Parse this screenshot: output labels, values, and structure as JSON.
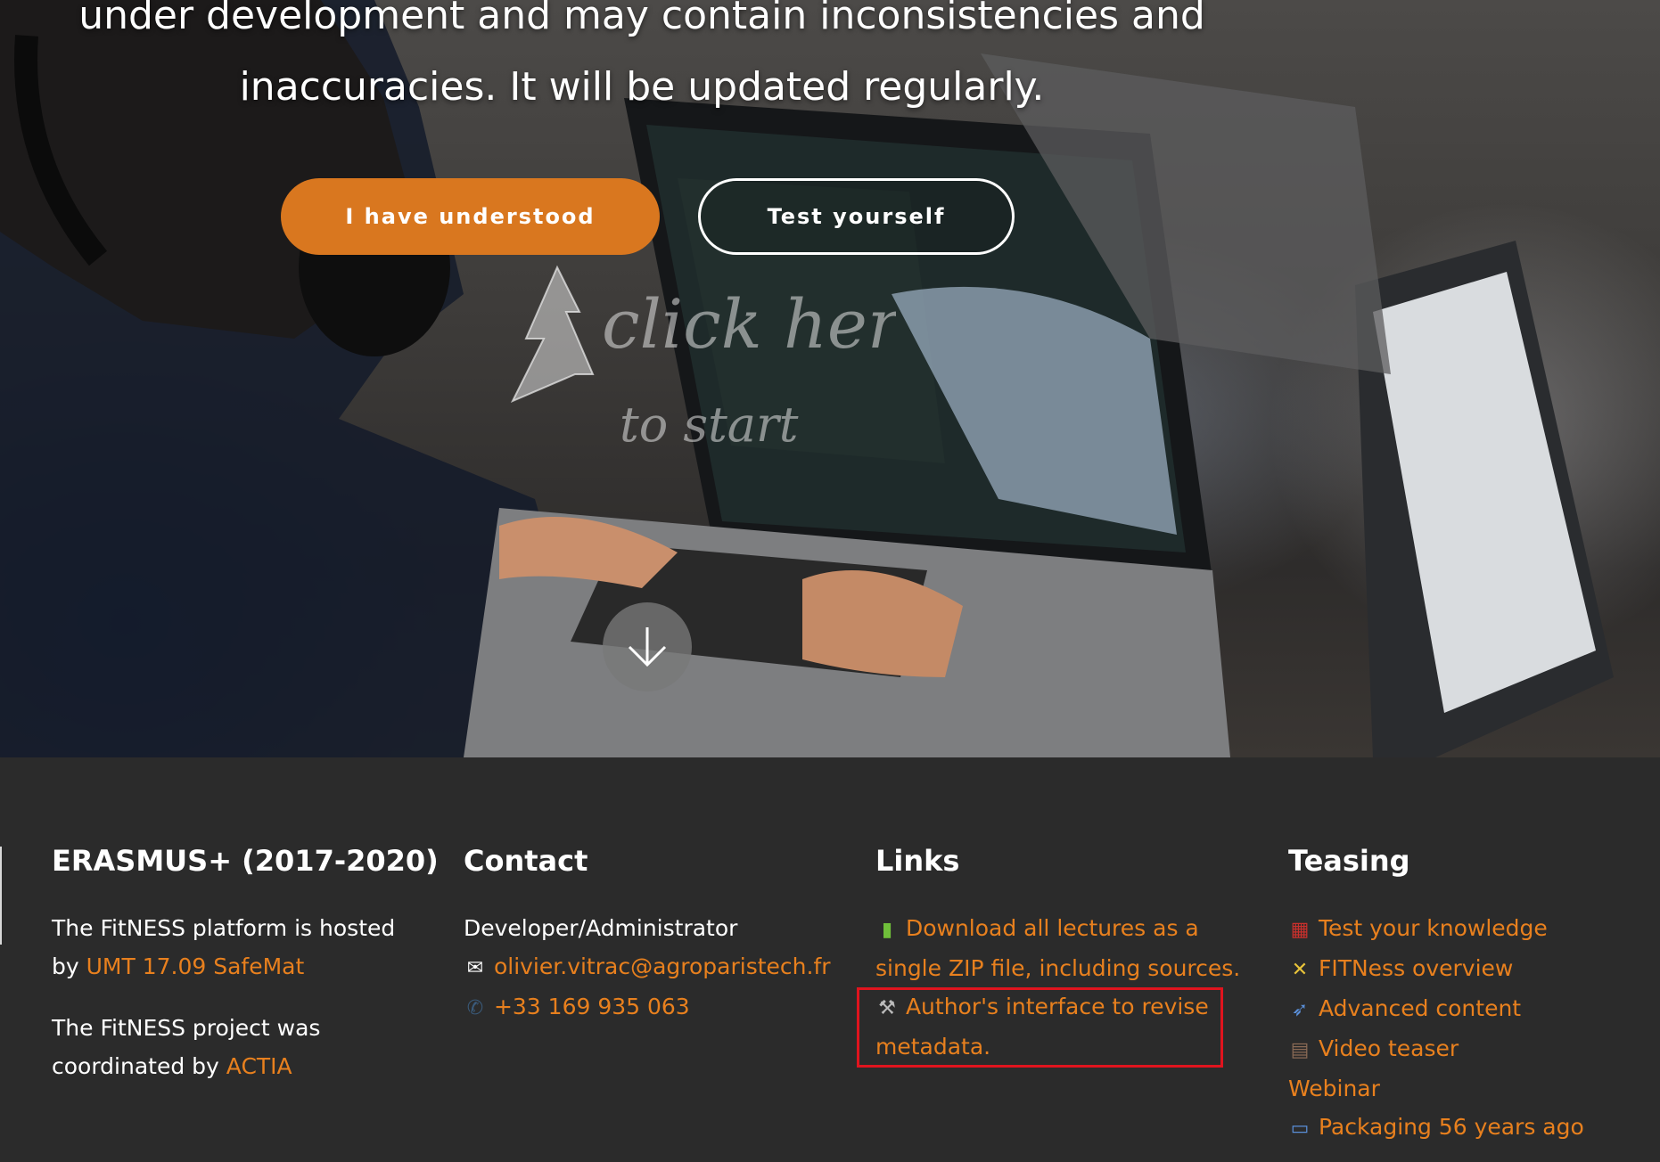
{
  "hero": {
    "title_line1": "under development and may contain inconsistencies and",
    "title_line2": "inaccuracies. It will be updated regularly.",
    "primary_button": "I have understood",
    "secondary_button": "Test yourself",
    "handwritten_1": "click here",
    "handwritten_2": "to start",
    "scroll_icon": "arrow-down-icon"
  },
  "footer": {
    "erasmus": {
      "heading": "ERASMUS+ (2017-2020)",
      "hosted_prefix": "The FitNESS platform is hosted",
      "hosted_by": "by",
      "hosted_link": "UMT 17.09 SafeMat",
      "coordinated_line1": "The FitNESS project was",
      "coordinated_by": "coordinated by",
      "coordinated_link": "ACTIA"
    },
    "contact": {
      "heading": "Contact",
      "role": "Developer/Administrator",
      "email_icon": "envelope-icon",
      "email": "olivier.vitrac@agroparistech.fr",
      "phone_icon": "phone-icon",
      "phone": "+33 169 935 063"
    },
    "links": {
      "heading": "Links",
      "items": [
        {
          "icon": "can-icon",
          "text_line1": "Download all lectures as a",
          "text_line2": "single ZIP file, including sources."
        },
        {
          "icon": "tools-icon",
          "text_line1": "Author's interface to revise",
          "text_line2": "metadata."
        }
      ]
    },
    "teasing": {
      "heading": "Teasing",
      "items": [
        {
          "icon": "abacus-icon",
          "text": "Test your knowledge"
        },
        {
          "icon": "satellite-icon",
          "text": "FITNess overview"
        },
        {
          "icon": "rocket-icon",
          "text": "Advanced content"
        },
        {
          "icon": "film-icon",
          "text": "Video teaser"
        },
        {
          "icon": "",
          "text": "Webinar"
        },
        {
          "icon": "pill-icon",
          "text": "Packaging 56 years ago"
        }
      ]
    }
  },
  "colors": {
    "accent": "#d9771f",
    "link": "#e8801e",
    "footer_bg": "#2b2b2b",
    "highlight": "#e0141e"
  }
}
